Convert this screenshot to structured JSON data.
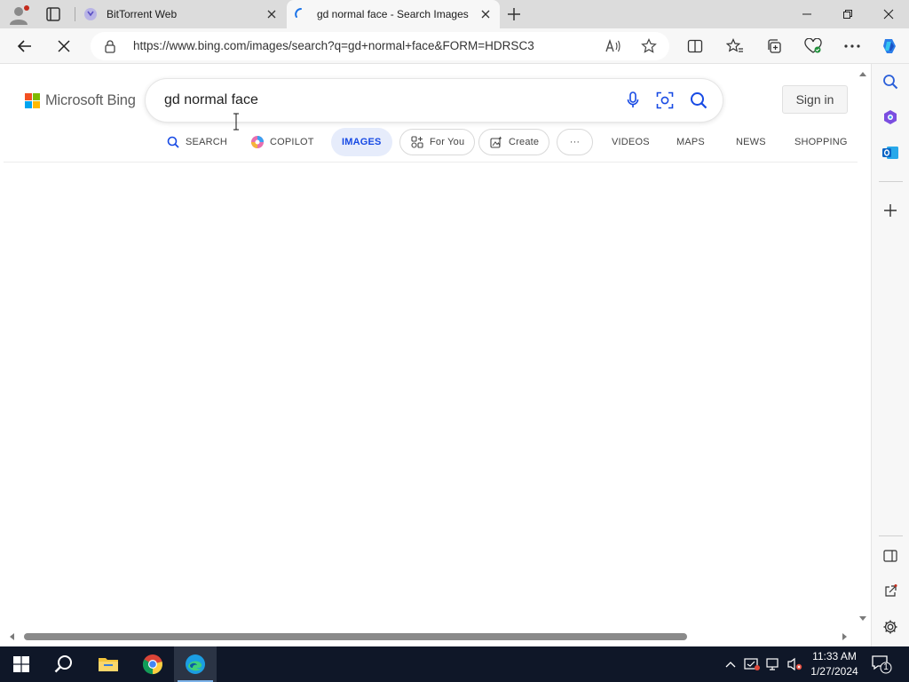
{
  "browser": {
    "tabs": [
      {
        "title": "BitTorrent Web",
        "active": false,
        "favicon": "bittorrent-icon"
      },
      {
        "title": "gd normal face - Search Images",
        "active": true,
        "favicon": "loading-spinner-icon"
      }
    ],
    "address": {
      "url": "https://www.bing.com/images/search?q=gd+normal+face&FORM=HDRSC3"
    },
    "loading": true
  },
  "page": {
    "brand": "Microsoft Bing",
    "search": {
      "query": "gd normal face"
    },
    "signin_label": "Sign in",
    "scopes": [
      {
        "label": "SEARCH",
        "icon": "search-icon"
      },
      {
        "label": "COPILOT",
        "icon": "copilot-icon"
      },
      {
        "label": "IMAGES",
        "active": true
      },
      {
        "label": "For You",
        "icon": "for-you-icon"
      },
      {
        "label": "Create",
        "icon": "create-icon"
      },
      {
        "label": "···",
        "icon": "more-icon"
      },
      {
        "label": "VIDEOS"
      },
      {
        "label": "MAPS"
      },
      {
        "label": "NEWS"
      },
      {
        "label": "SHOPPING"
      }
    ]
  },
  "taskbar": {
    "time": "11:33 AM",
    "date": "1/27/2024",
    "notification_count": "1"
  },
  "colors": {
    "accent": "#174ae4",
    "active_scope_bg": "#e6ecfb",
    "taskbar_bg": "#0f1728"
  }
}
